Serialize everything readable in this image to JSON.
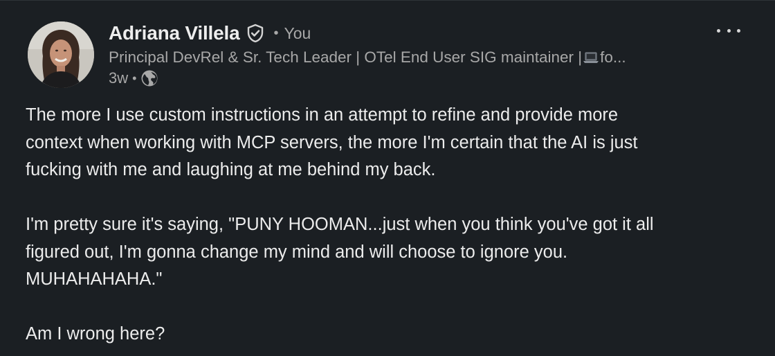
{
  "post": {
    "author": {
      "name": "Adriana Villela",
      "relation_separator": "•",
      "relation": "You",
      "headline_before_emoji": "Principal DevRel & Sr. Tech Leader | OTel End User SIG maintainer |",
      "headline_after_emoji": "fo...",
      "headline_emoji_icon": "laptop-icon",
      "verified_icon": "verified-shield-icon"
    },
    "meta": {
      "age": "3w",
      "separator": "•",
      "visibility_icon": "globe-icon"
    },
    "menu_icon": "more-options-icon",
    "body": {
      "paragraph1": [
        "The more I use custom instructions in an attempt to refine and provide more",
        "context when working with MCP servers, the more I'm certain that the AI is just",
        "fucking with me and laughing at me behind my back."
      ],
      "paragraph2": [
        "I'm pretty sure it's saying, \"PUNY HOOMAN...just when you think you've got it all",
        "figured out, I'm gonna change my mind and will choose to ignore you.",
        "MUHAHAHAHA.\""
      ],
      "paragraph3": [
        "Am I wrong here?"
      ]
    }
  },
  "colors": {
    "background": "#1b1f23",
    "primary_text": "#ececec",
    "secondary_text": "#a8a8a8"
  }
}
